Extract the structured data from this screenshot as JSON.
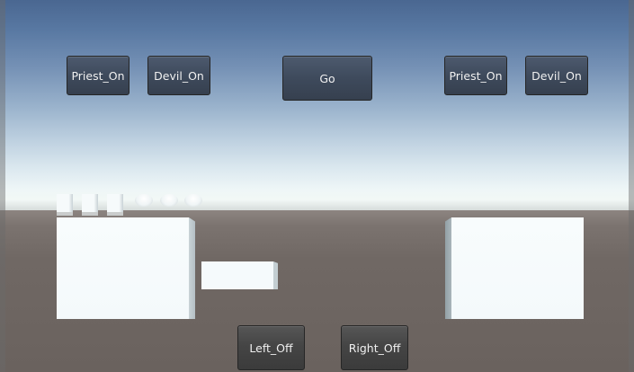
{
  "buttons": {
    "priest_on_left": "Priest_On",
    "devil_on_left": "Devil_On",
    "go": "Go",
    "priest_on_right": "Priest_On",
    "devil_on_right": "Devil_On",
    "left_off": "Left_Off",
    "right_off": "Right_Off"
  },
  "scene": {
    "priests_on_left_shore": 3,
    "devils_on_left_shore": 3,
    "priests_on_right_shore": 0,
    "devils_on_right_shore": 0,
    "boat_side": "left",
    "boat_passengers": 0
  },
  "colors": {
    "sky_top": "#4a6791",
    "horizon": "#f2f8f6",
    "ground": "#6b6460",
    "object_white": "#f6fafb",
    "button_dark": "#454545"
  }
}
